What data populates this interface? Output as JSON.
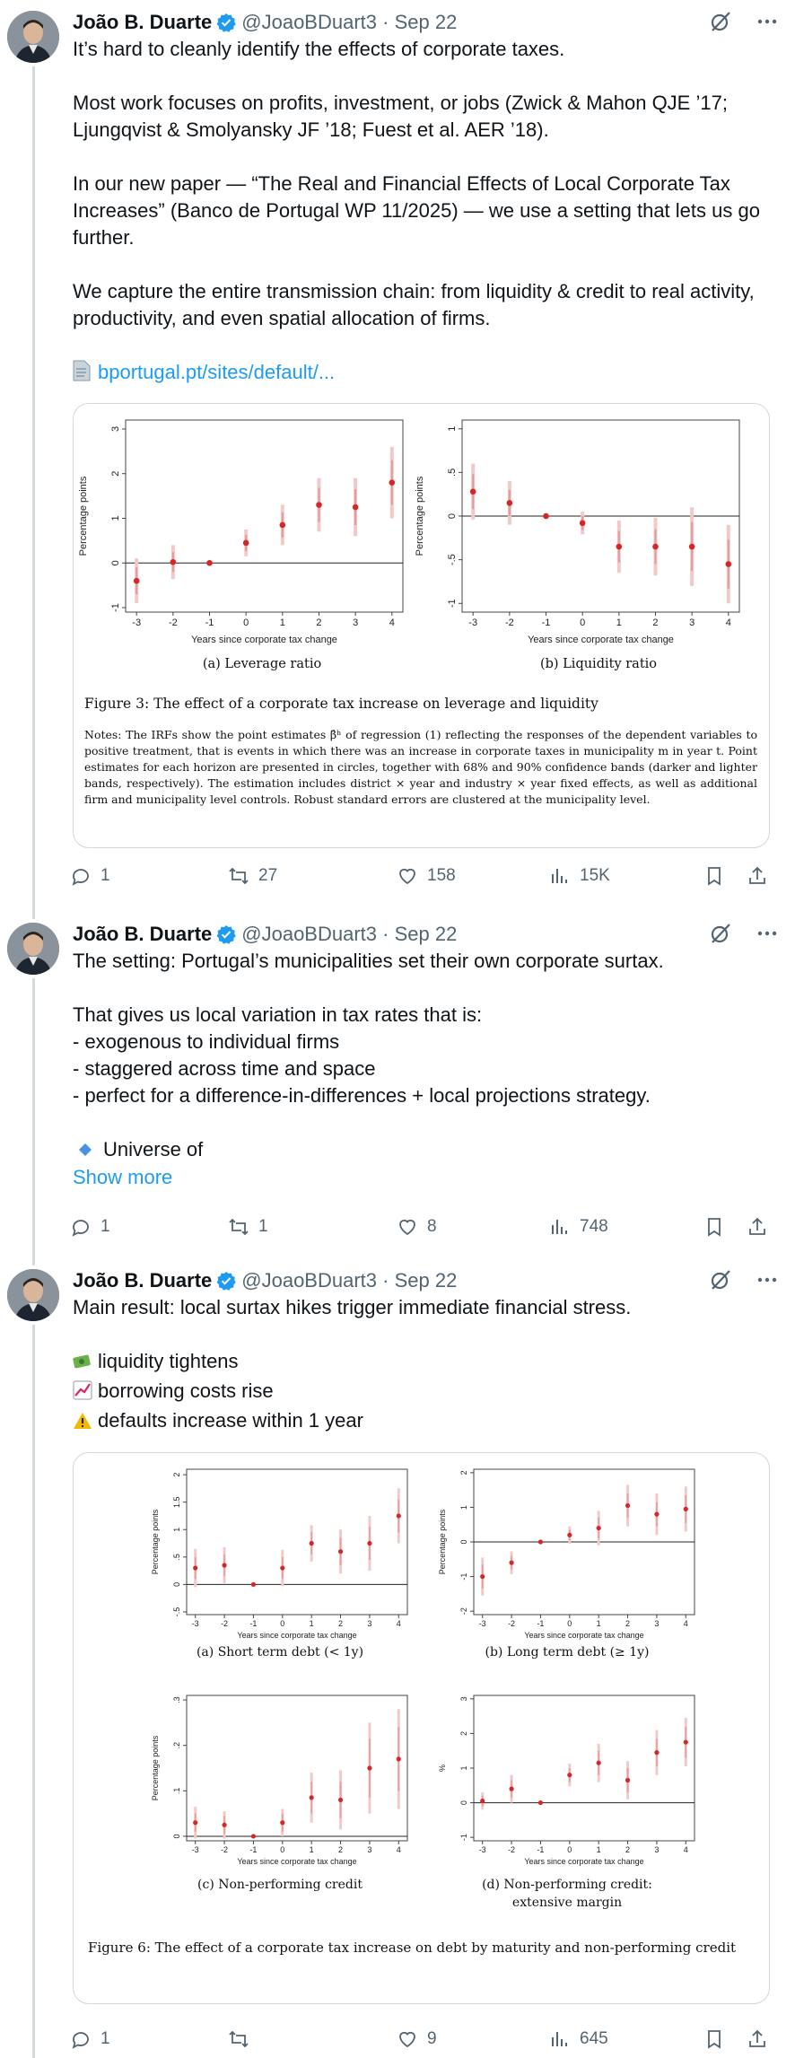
{
  "tweets": [
    {
      "author": {
        "name": "João B. Duarte",
        "handle": "@JoaoBDuart3",
        "date": "Sep 22"
      },
      "body": {
        "line1": "It’s hard to cleanly identify the effects of corporate taxes.",
        "line2": "Most work focuses on profits, investment, or jobs (Zwick & Mahon QJE ’17; Ljungqvist & Smolyansky JF ’18; Fuest et al. AER ’18).",
        "line3": "In our new paper — “The Real and Financial Effects of Local Corporate Tax Increases” (Banco de Portugal WP 11/2025) — we use a setting that lets us go further.",
        "line4": "We capture the entire transmission chain: from liquidity & credit to real activity, productivity, and even spatial allocation of firms.",
        "link_text": "bportugal.pt/sites/default/..."
      },
      "figure": {
        "panel_a_caption": "(a) Leverage ratio",
        "panel_b_caption": "(b) Liquidity ratio",
        "title": "Figure 3: The effect of a corporate tax increase on leverage and liquidity",
        "notes": "Notes: The IRFs show the point estimates β̂ʰ of regression (1) reflecting the responses of the dependent variables to positive treatment, that is events in which there was an increase in corporate taxes in municipality m in year t. Point estimates for each horizon are presented in circles, together with 68% and 90% confidence bands (darker and lighter bands, respectively). The estimation includes district × year and industry × year fixed effects, as well as additional firm and municipality level controls. Robust standard errors are clustered at the municipality level."
      },
      "stats": {
        "replies": "1",
        "reposts": "27",
        "likes": "158",
        "views": "15K"
      }
    },
    {
      "author": {
        "name": "João B. Duarte",
        "handle": "@JoaoBDuart3",
        "date": "Sep 22"
      },
      "body": {
        "line1": "The setting: Portugal’s municipalities set their own corporate surtax.",
        "line2": "That gives us local variation in tax rates that is:",
        "line3": "- exogenous to individual firms",
        "line4": "- staggered across time and space",
        "line5": "- perfect for a difference-in-differences + local projections strategy.",
        "line6": "Universe of",
        "show_more": "Show more"
      },
      "stats": {
        "replies": "1",
        "reposts": "1",
        "likes": "8",
        "views": "748"
      }
    },
    {
      "author": {
        "name": "João B. Duarte",
        "handle": "@JoaoBDuart3",
        "date": "Sep 22"
      },
      "body": {
        "line1": "Main result: local surtax hikes trigger immediate financial stress.",
        "line2": "liquidity tightens",
        "line3": "borrowing costs rise",
        "line4": "defaults increase within 1 year"
      },
      "figure": {
        "panel_a_caption": "(a) Short term debt (< 1y)",
        "panel_b_caption": "(b) Long term debt (≥ 1y)",
        "panel_c_caption": "(c) Non-performing credit",
        "panel_d_caption_1": "(d) Non-performing credit:",
        "panel_d_caption_2": "extensive margin",
        "title": "Figure 6: The effect of a corporate tax increase on debt by maturity and non-performing credit"
      },
      "stats": {
        "replies": "1",
        "reposts": "",
        "likes": "9",
        "views": "645"
      }
    }
  ],
  "icons": [
    "verified-badge-icon",
    "grok-icon",
    "more-icon",
    "reply-icon",
    "repost-icon",
    "like-icon",
    "views-icon",
    "bookmark-icon",
    "share-icon",
    "document-icon",
    "diamond-icon",
    "money-icon",
    "chart-up-icon",
    "warning-icon"
  ],
  "colors": {
    "accent": "#1d9bf0",
    "muted": "#536471",
    "point": "#d62728"
  },
  "chart_data": [
    {
      "type": "scatter",
      "id": "fig3a",
      "x": [
        -3,
        -2,
        -1,
        0,
        1,
        2,
        3,
        4
      ],
      "values": [
        -0.4,
        0.02,
        0,
        0.45,
        0.85,
        1.3,
        1.25,
        1.8
      ],
      "ci68_half": [
        0.3,
        0.22,
        0,
        0.18,
        0.28,
        0.38,
        0.4,
        0.5
      ],
      "ci90_half": [
        0.5,
        0.38,
        0,
        0.3,
        0.45,
        0.6,
        0.65,
        0.8
      ],
      "xlabel": "Years since corporate tax change",
      "ylabel": "Percentage points",
      "ylim": [
        -1.1,
        3.2
      ],
      "yticks": [
        -1,
        0,
        1,
        2,
        3
      ]
    },
    {
      "type": "scatter",
      "id": "fig3b",
      "x": [
        -3,
        -2,
        -1,
        0,
        1,
        2,
        3,
        4
      ],
      "values": [
        0.28,
        0.15,
        0,
        -0.08,
        -0.35,
        -0.35,
        -0.35,
        -0.55
      ],
      "ci68_half": [
        0.2,
        0.15,
        0,
        0.08,
        0.18,
        0.2,
        0.28,
        0.28
      ],
      "ci90_half": [
        0.32,
        0.25,
        0,
        0.13,
        0.3,
        0.33,
        0.45,
        0.45
      ],
      "xlabel": "Years since corporate tax change",
      "ylabel": "Percentage points",
      "ylim": [
        -1.1,
        1.1
      ],
      "yticks": [
        -1,
        -0.5,
        0,
        0.5,
        1
      ]
    },
    {
      "type": "scatter",
      "id": "fig6a",
      "x": [
        -3,
        -2,
        -1,
        0,
        1,
        2,
        3,
        4
      ],
      "values": [
        0.3,
        0.35,
        0,
        0.3,
        0.75,
        0.6,
        0.75,
        1.25
      ],
      "ci68_half": [
        0.2,
        0.2,
        0,
        0.2,
        0.2,
        0.25,
        0.3,
        0.3
      ],
      "ci90_half": [
        0.35,
        0.33,
        0,
        0.33,
        0.33,
        0.4,
        0.5,
        0.5
      ],
      "xlabel": "Years since corporate tax change",
      "ylabel": "Percentage points",
      "ylim": [
        -0.55,
        2.1
      ],
      "yticks": [
        -0.5,
        0,
        0.5,
        1,
        1.5,
        2
      ]
    },
    {
      "type": "scatter",
      "id": "fig6b",
      "x": [
        -3,
        -2,
        -1,
        0,
        1,
        2,
        3,
        4
      ],
      "values": [
        -1,
        -0.6,
        0,
        0.2,
        0.4,
        1.05,
        0.8,
        0.95
      ],
      "ci68_half": [
        0.35,
        0.2,
        0,
        0.15,
        0.3,
        0.35,
        0.35,
        0.4
      ],
      "ci90_half": [
        0.55,
        0.33,
        0,
        0.25,
        0.5,
        0.6,
        0.6,
        0.65
      ],
      "xlabel": "Years since corporate tax change",
      "ylabel": "Percentage points",
      "ylim": [
        -2.1,
        2.1
      ],
      "yticks": [
        -2,
        -1,
        0,
        1,
        2
      ]
    },
    {
      "type": "scatter",
      "id": "fig6c",
      "x": [
        -3,
        -2,
        -1,
        0,
        1,
        2,
        3,
        4
      ],
      "values": [
        0.03,
        0.025,
        0,
        0.03,
        0.085,
        0.08,
        0.15,
        0.17
      ],
      "ci68_half": [
        0.02,
        0.02,
        0,
        0.02,
        0.035,
        0.04,
        0.065,
        0.07
      ],
      "ci90_half": [
        0.035,
        0.03,
        0,
        0.03,
        0.055,
        0.065,
        0.1,
        0.11
      ],
      "xlabel": "Years since corporate tax change",
      "ylabel": "Percentage points",
      "ylim": [
        -0.01,
        0.31
      ],
      "yticks": [
        0,
        0.1,
        0.2,
        0.3
      ]
    },
    {
      "type": "scatter",
      "id": "fig6d",
      "x": [
        -3,
        -2,
        -1,
        0,
        1,
        2,
        3,
        4
      ],
      "values": [
        0.05,
        0.4,
        0,
        0.8,
        1.15,
        0.65,
        1.45,
        1.75
      ],
      "ci68_half": [
        0.15,
        0.25,
        0,
        0.2,
        0.35,
        0.35,
        0.4,
        0.45
      ],
      "ci90_half": [
        0.25,
        0.4,
        0,
        0.33,
        0.55,
        0.55,
        0.65,
        0.7
      ],
      "xlabel": "Years since corporate tax change",
      "ylabel": "%",
      "ylim": [
        -1.1,
        3.1
      ],
      "yticks": [
        -1,
        0,
        1,
        2,
        3
      ]
    }
  ]
}
